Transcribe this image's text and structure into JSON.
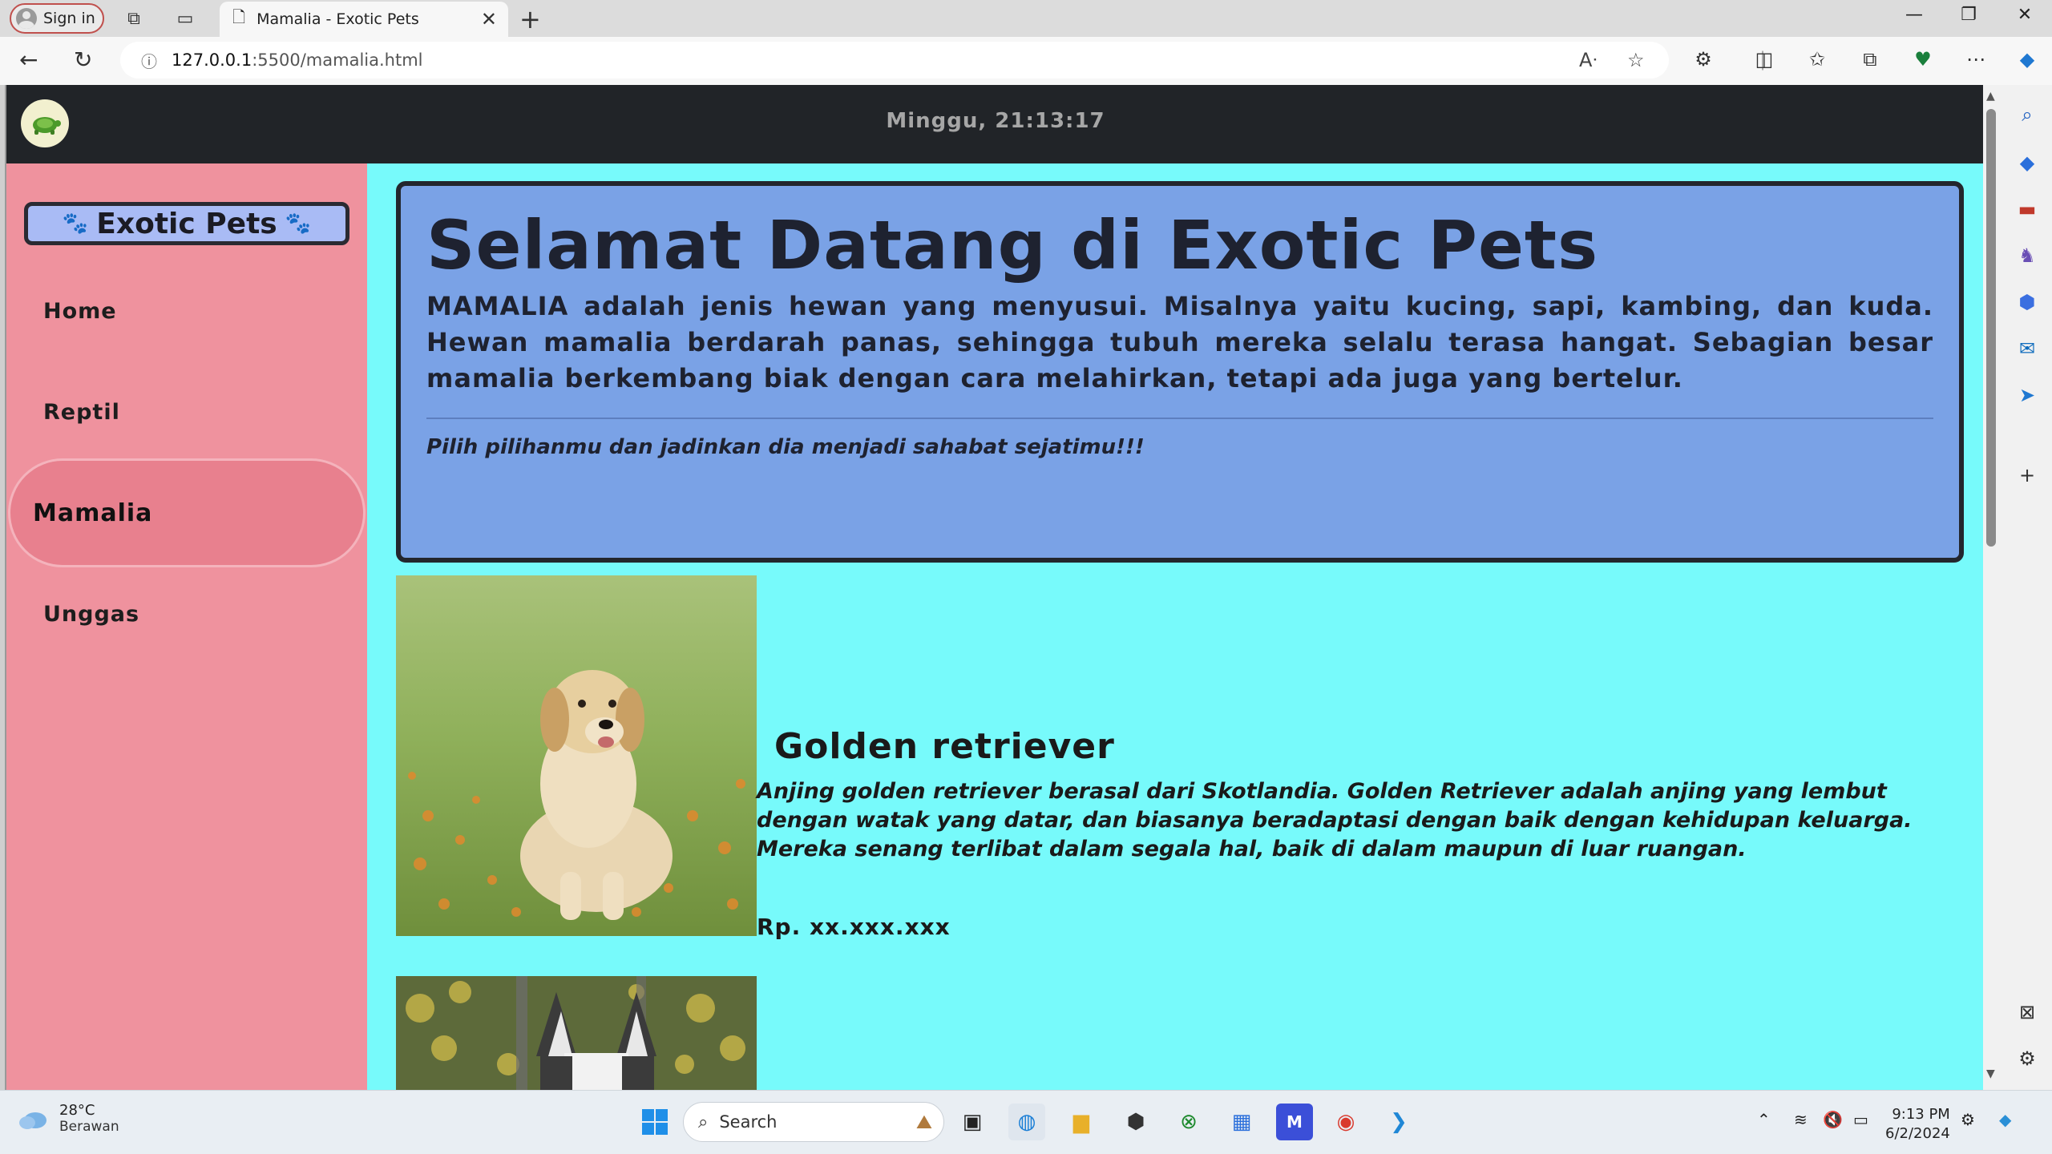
{
  "browser": {
    "signin_label": "Sign in",
    "tab_title": "Mamalia - Exotic Pets",
    "url_host": "127.0.0.1",
    "url_path": ":5500/mamalia.html"
  },
  "site": {
    "clock_text": "Minggu, 21:13:17",
    "brand": "Exotic Pets",
    "nav": [
      {
        "label": "Home"
      },
      {
        "label": "Reptil"
      },
      {
        "label": "Mamalia"
      },
      {
        "label": "Unggas"
      }
    ],
    "hero": {
      "title": "Selamat Datang di Exotic Pets",
      "desc_strong": "MAMALIA",
      "desc_rest": " adalah jenis hewan yang menyusui. Misalnya yaitu kucing, sapi, kambing, dan kuda. Hewan mamalia berdarah panas, sehingga tubuh mereka selalu terasa hangat. Sebagian besar mamalia berkembang biak dengan cara melahirkan, tetapi ada juga yang bertelur.",
      "cta": "Pilih pilihanmu dan jadinkan dia menjadi sahabat sejatimu!!!"
    },
    "pets": [
      {
        "name": "Golden retriever",
        "description": "Anjing golden retriever berasal dari Skotlandia. Golden Retriever adalah anjing yang lembut dengan watak yang datar, dan biasanya beradaptasi dengan baik dengan kehidupan keluarga. Mereka senang terlibat dalam segala hal, baik di dalam maupun di luar ruangan.",
        "price": "Rp. xx.xxx.xxx"
      }
    ]
  },
  "taskbar": {
    "weather_temp": "28°C",
    "weather_desc": "Berawan",
    "search_label": "Search",
    "time": "9:13 PM",
    "date": "6/2/2024"
  }
}
